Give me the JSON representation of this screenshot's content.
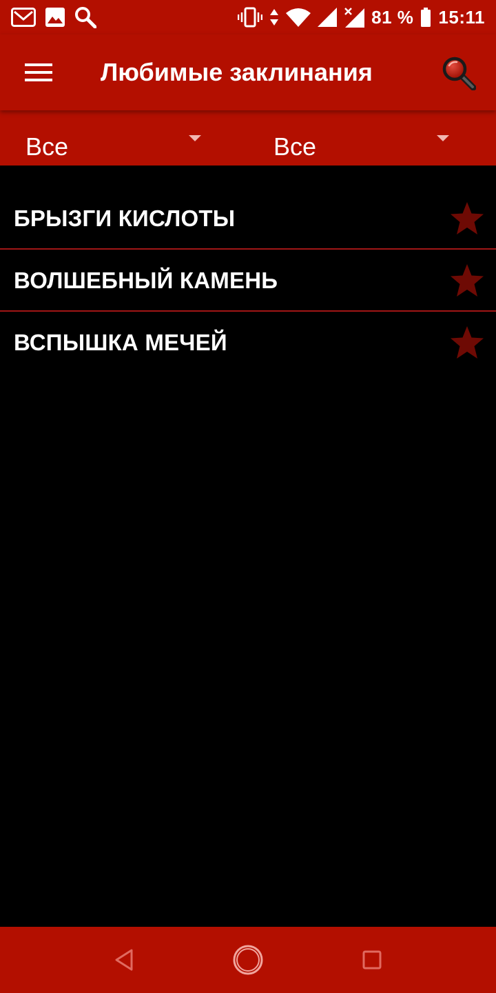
{
  "status_bar": {
    "battery_percent": "81 %",
    "time": "15:11",
    "left_icons": [
      "gmail-icon",
      "gallery-icon",
      "search-icon"
    ],
    "right_icons": [
      "vibrate-icon",
      "data-arrows-icon",
      "wifi-icon",
      "signal-icon",
      "signal-no-service-icon",
      "battery-icon"
    ]
  },
  "app_bar": {
    "title": "Любимые заклинания",
    "menu_icon": "hamburger-menu-icon",
    "search_icon": "search-icon"
  },
  "filters": [
    {
      "value": "Все"
    },
    {
      "value": "Все"
    }
  ],
  "spells": [
    {
      "name": "БРЫЗГИ КИСЛОТЫ",
      "favorite": true
    },
    {
      "name": "ВОЛШЕБНЫЙ КАМЕНЬ",
      "favorite": true
    },
    {
      "name": "ВСПЫШКА МЕЧЕЙ",
      "favorite": true
    }
  ],
  "nav_bar": {
    "icons": [
      "back-icon",
      "home-icon",
      "recents-icon"
    ]
  },
  "colors": {
    "primary": "#b30f00",
    "background": "#000000",
    "divider": "#a11616",
    "star": "#6e0a04",
    "text": "#ffffff"
  }
}
